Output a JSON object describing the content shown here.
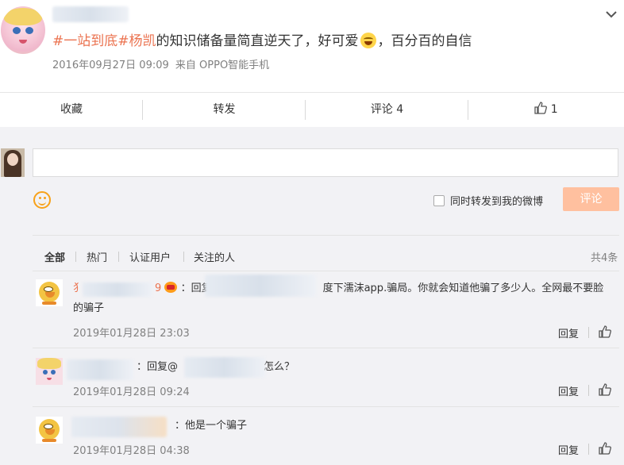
{
  "post": {
    "topic_1": "#一站到底#",
    "topic_2": "杨凯",
    "text_before_emoji": "的知识储备量简直逆天了，好可爱",
    "text_after_emoji": "，百分百的自信",
    "date": "2016年09月27日 09:09",
    "source": "来自 OPPO智能手机"
  },
  "actions": {
    "favorite": "收藏",
    "repost": "转发",
    "comment": "评论 4",
    "like_count": "1"
  },
  "compose": {
    "repost_checkbox_label": "同时转发到我的微博",
    "submit_label": "评论"
  },
  "filters": {
    "items": [
      "全部",
      "热门",
      "认证用户",
      "关注的人"
    ],
    "total": "共4条"
  },
  "comments": [
    {
      "name_start": "犭",
      "name_end": "9",
      "text_line1_prefix": "：回复",
      "text_line1_suffix": "度下濡沫app.骗局。你就会知道他骗了多少人。全网最不要脸",
      "text_line2": "的骗子",
      "time": "2019年01月28日 23:03",
      "reply_label": "回复"
    },
    {
      "text_prefix": "：回复@",
      "text_suffix": "怎么？",
      "time": "2019年01月28日 09:24",
      "reply_label": "回复"
    },
    {
      "text": "：他是一个骗子",
      "time": "2019年01月28日 04:38",
      "reply_label": "回复"
    }
  ]
}
